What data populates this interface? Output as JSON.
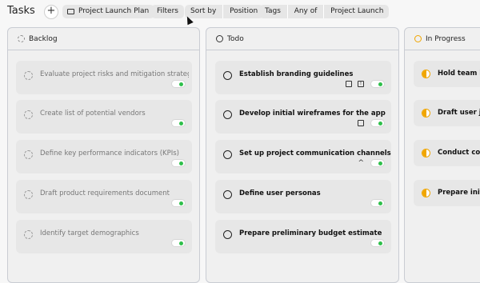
{
  "app": {
    "title": "Tasks"
  },
  "toolbar": {
    "add_label": "+",
    "project_label": "Project Launch Plan",
    "filters_label": "Filters",
    "sort_by_label": "Sort by",
    "sort_value": "Position",
    "tags_label": "Tags",
    "tags_operator": "Any of",
    "tags_value": "Project Launch"
  },
  "columns": [
    {
      "title": "Backlog",
      "status": "dashed",
      "cards": [
        {
          "label": "Evaluate project risks and mitigation strategie"
        },
        {
          "label": "Create list of potential vendors"
        },
        {
          "label": "Define key performance indicators (KPIs)"
        },
        {
          "label": "Draft product requirements document"
        },
        {
          "label": "Identify target demographics"
        }
      ]
    },
    {
      "title": "Todo",
      "status": "solid",
      "cards": [
        {
          "label": "Establish branding guidelines"
        },
        {
          "label": "Develop initial wireframes for the app"
        },
        {
          "label": "Set up project communication channels"
        },
        {
          "label": "Define user personas"
        },
        {
          "label": "Prepare preliminary budget estimate"
        }
      ]
    },
    {
      "title": "In Progress",
      "status": "progress",
      "cards": [
        {
          "label": "Hold team br"
        },
        {
          "label": "Draft user jou"
        },
        {
          "label": "Conduct comp"
        },
        {
          "label": "Prepare initial"
        }
      ]
    }
  ]
}
